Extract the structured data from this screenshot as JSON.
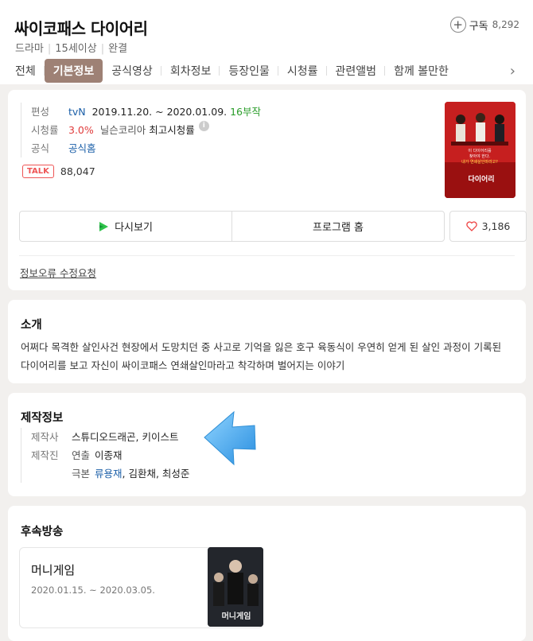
{
  "show": {
    "title": "싸이코패스 다이어리",
    "genre": "드라마",
    "rating": "15세이상",
    "status": "완결"
  },
  "subscribe": {
    "label": "구독",
    "count": "8,292"
  },
  "tabs": [
    "전체",
    "기본정보",
    "공식영상",
    "회차정보",
    "등장인물",
    "시청률",
    "관련앨범",
    "함께 볼만한"
  ],
  "active_tab": "기본정보",
  "info": {
    "broadcast_label": "편성",
    "channel": "tvN",
    "period": "2019.11.20. ~ 2020.01.09.",
    "episodes": "16부작",
    "ratings_label": "시청률",
    "ratings_value": "3.0%",
    "ratings_source": "닐슨코리아",
    "ratings_note": "최고시청률",
    "official_label": "공식",
    "official_link": "공식홈",
    "talk_badge": "TALK",
    "talk_count": "88,047"
  },
  "buttons": {
    "rewatch": "다시보기",
    "program_home": "프로그램 홈",
    "like_count": "3,186",
    "report": "정보오류 수정요청"
  },
  "poster_text": {
    "line1": "이 다이어리를",
    "line2": "찾아야 한다.",
    "line3": "내가 연쇄살인마라고?",
    "logo": "다이어리"
  },
  "intro": {
    "heading": "소개",
    "text": "어쩌다 목격한 살인사건 현장에서 도망치던 중 사고로 기억을 잃은 호구 육동식이 우연히 얻게 된 살인 과정이 기록된 다이어리를 보고 자신이 싸이코패스 연쇄살인마라고 착각하며 벌어지는 이야기"
  },
  "production": {
    "heading": "제작정보",
    "company_label": "제작사",
    "company": "스튜디오드래곤, 키이스트",
    "staff_label": "제작진",
    "director_label": "연출",
    "director": "이종재",
    "writer_label": "극본",
    "writer_main": "류용재",
    "writer_rest": ", 김환채, 최성준"
  },
  "next": {
    "heading": "후속방송",
    "title": "머니게임",
    "period": "2020.01.15. ~ 2020.03.05.",
    "poster_logo": "머니게임"
  },
  "colors": {
    "active_tab": "#9e8175",
    "link_blue": "#1b5fa8",
    "episodes_green": "#2a9d2a",
    "rating_red": "#e03b3b",
    "talk_red": "#e55555",
    "annotation_arrow": "#3aa0e8"
  }
}
